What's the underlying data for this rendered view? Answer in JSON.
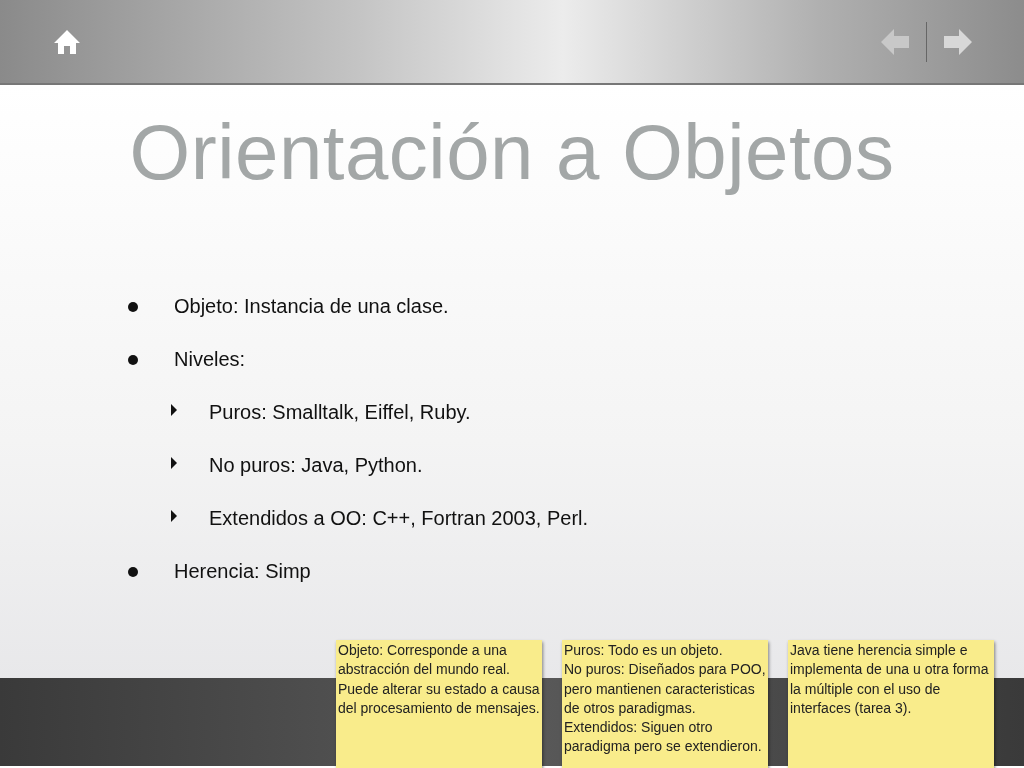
{
  "title": "Orientación a Objetos",
  "bullets": [
    {
      "text": "Objeto: Instancia de una clase."
    },
    {
      "text": "Niveles:",
      "children": [
        {
          "text": "Puros: Smalltalk, Eiffel, Ruby."
        },
        {
          "text": "No puros: Java, Python."
        },
        {
          "text": "Extendidos a OO: C++, Fortran 2003, Perl."
        }
      ]
    },
    {
      "text": "Herencia: Simp"
    }
  ],
  "notes": [
    {
      "text": "Objeto: Corresponde a una abstracción del mundo real. Puede alterar su estado a causa del procesamiento de mensajes."
    },
    {
      "text": "Puros: Todo es un objeto.\nNo puros: Diseñados para POO, pero mantienen caracteristicas de otros paradigmas.\nExtendidos: Siguen otro paradigma pero se extendieron."
    },
    {
      "text": "Java tiene herencia simple e implementa de una u otra forma la múltiple con el uso de interfaces (tarea 3)."
    }
  ]
}
